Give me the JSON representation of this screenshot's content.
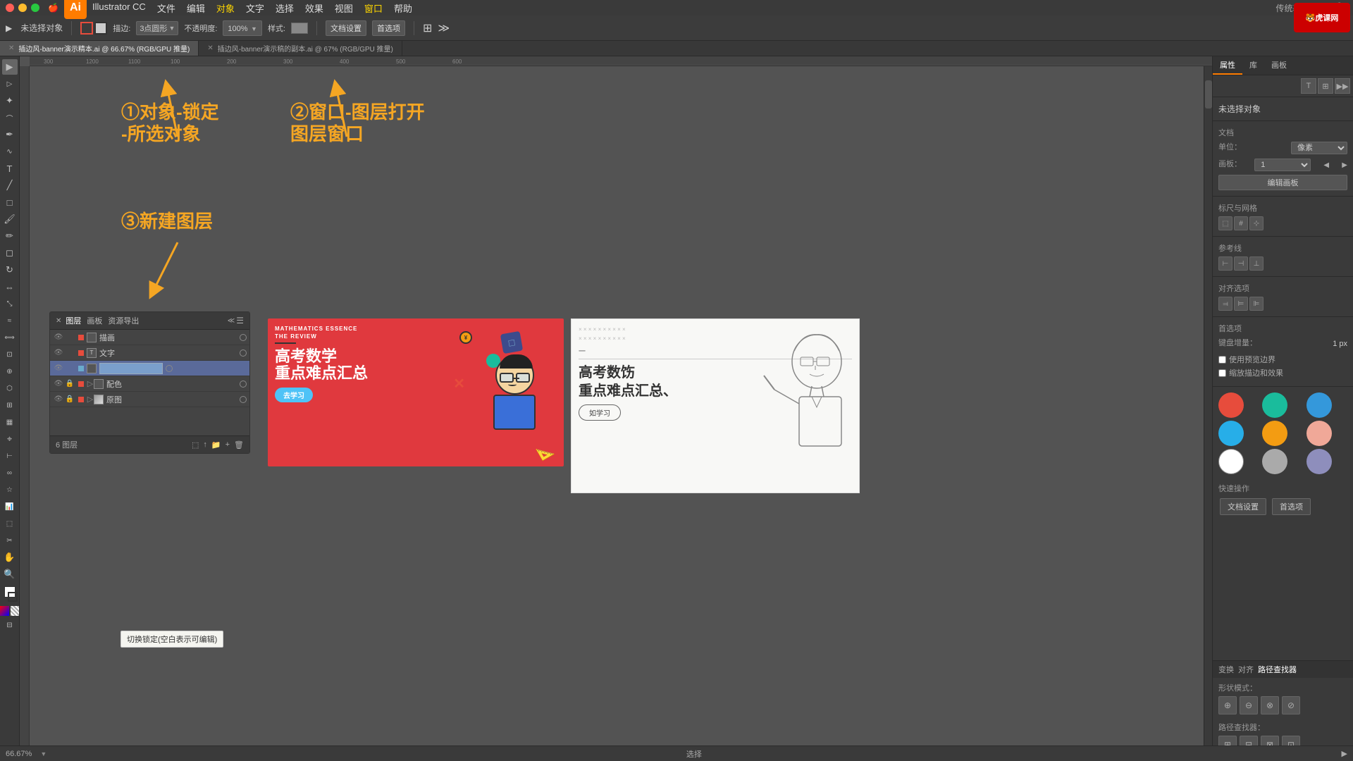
{
  "app": {
    "name": "Illustrator CC",
    "logo": "Ai",
    "version": "66.67%"
  },
  "mac_menu": {
    "apple": "🍎",
    "items": [
      "Illustrator CC",
      "文件",
      "编辑",
      "对象",
      "文字",
      "选择",
      "效果",
      "视图",
      "窗口",
      "帮助"
    ]
  },
  "toolbar": {
    "no_selection": "未选择对象",
    "stroke": "描边:",
    "stroke_type": "3点圆形",
    "opacity": "不透明度:",
    "opacity_value": "100%",
    "style": "样式:",
    "doc_settings": "文档设置",
    "preferences": "首选项"
  },
  "tabs": [
    {
      "label": "插边风-banner演示精本.ai @ 66.67% (RGB/GPU 推量)",
      "active": true
    },
    {
      "label": "插边风-banner演示稿的副本.ai @ 67% (RGB/GPU 推量)",
      "active": false
    }
  ],
  "annotations": {
    "ann1": "①对象-锁定\n-所选对象",
    "ann2": "②窗口-图层打开\n图层窗口",
    "ann3": "③新建图层"
  },
  "layers_panel": {
    "title": "图层",
    "tabs": [
      "图层",
      "画板",
      "资源导出"
    ],
    "layers": [
      {
        "name": "描画",
        "visible": true,
        "locked": false,
        "color": "#e74c3c",
        "active": false,
        "expand": false
      },
      {
        "name": "文字",
        "visible": true,
        "locked": false,
        "color": "#e74c3c",
        "active": false,
        "expand": false
      },
      {
        "name": "",
        "visible": true,
        "locked": false,
        "color": "#6aa",
        "active": true,
        "expand": false,
        "editing": true
      },
      {
        "name": "配色",
        "visible": true,
        "locked": true,
        "color": "#e74c3c",
        "active": false,
        "expand": true,
        "sub": true
      },
      {
        "name": "原图",
        "visible": true,
        "locked": true,
        "color": "#e74c3c",
        "active": false,
        "expand": true,
        "sub": true
      }
    ],
    "count": "6 图层",
    "tooltip": "切换锁定(空白表示可编辑)"
  },
  "right_panel": {
    "tabs": [
      "属性",
      "库",
      "画板"
    ],
    "active_tab": "属性",
    "no_selection": "未选择对象",
    "doc_section": "文档",
    "unit_label": "单位：",
    "unit_value": "像素",
    "artboard_label": "画板：",
    "artboard_value": "1",
    "edit_artboard_btn": "编辑画板",
    "align_label": "标尺与网格",
    "guides_label": "参考线",
    "align_objects_label": "对齐选项",
    "preferences_label": "首选项",
    "keyboard_step_label": "键盘增量：",
    "keyboard_step_value": "1 px",
    "use_preview_bounds": "使用预览边界",
    "scale_corners": "缩放描边和效果",
    "quick_actions": "快速操作",
    "doc_settings_btn": "文档设置",
    "preferences_btn": "首选项"
  },
  "colors": {
    "swatches": [
      {
        "color": "#e74c3c",
        "name": "red"
      },
      {
        "color": "#1abc9c",
        "name": "teal"
      },
      {
        "color": "#3498db",
        "name": "blue"
      },
      {
        "color": "#27aee8",
        "name": "light-blue"
      },
      {
        "color": "#f39c12",
        "name": "orange"
      },
      {
        "color": "#f0a898",
        "name": "pink"
      },
      {
        "color": "#ffffff",
        "name": "white"
      },
      {
        "color": "#aaaaaa",
        "name": "gray"
      },
      {
        "color": "#8e8ebc",
        "name": "purple-gray"
      }
    ]
  },
  "bottom_panel": {
    "tabs": [
      "变换",
      "对齐",
      "路径查找器"
    ],
    "active_tab": "路径查找器",
    "shape_mode_label": "形状模式：",
    "path_finder_label": "路径查找器："
  },
  "status_bar": {
    "zoom": "66.67%",
    "tool": "选择"
  },
  "watermark": "传统基本功能",
  "brand": "虎课网"
}
